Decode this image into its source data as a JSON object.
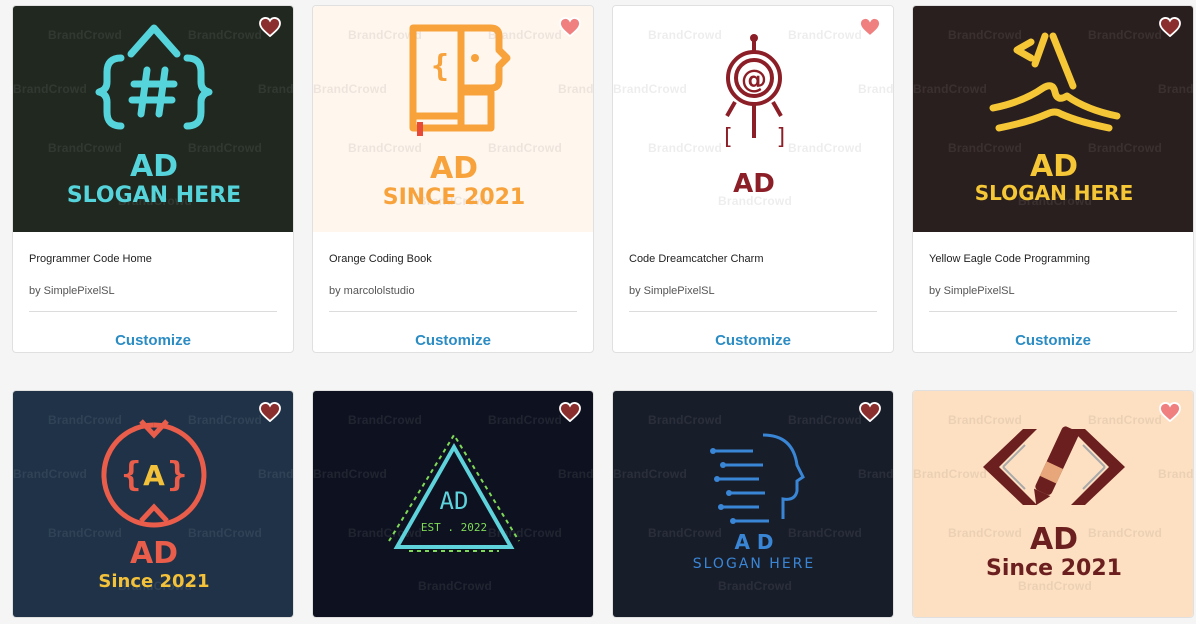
{
  "watermark": "BrandCrowd",
  "cards": [
    {
      "title": "Programmer Code Home",
      "author": "by SimplePixelSL",
      "action": "Customize",
      "logo": {
        "line1": "AD",
        "line2": "SLOGAN HERE",
        "icon": "hash-braces-icon",
        "bg": "#202820",
        "fg": "#56d4db",
        "heart": "#8b2e2e"
      }
    },
    {
      "title": "Orange Coding Book",
      "author": "by marcololstudio",
      "action": "Customize",
      "logo": {
        "line1": "AD",
        "line2": "SINCE 2021",
        "icon": "book-braces-icon",
        "bg": "#fff6ee",
        "fg": "#f7a23b",
        "heart": "#f08080"
      }
    },
    {
      "title": "Code Dreamcatcher Charm",
      "author": "by SimplePixelSL",
      "action": "Customize",
      "logo": {
        "line1": "AD",
        "line2": "",
        "icon": "dreamcatcher-at-icon",
        "bg": "#ffffff",
        "fg": "#8b1e26",
        "heart": "#f08080"
      }
    },
    {
      "title": "Yellow Eagle Code Programming",
      "author": "by SimplePixelSL",
      "action": "Customize",
      "logo": {
        "line1": "AD",
        "line2": "SLOGAN HERE",
        "icon": "eagle-code-icon",
        "bg": "#2a1f1f",
        "fg": "#f5c736",
        "heart": "#8b2e2e"
      }
    },
    {
      "logo": {
        "line1": "AD",
        "line2": "Since 2021",
        "icon": "circle-a-braces-icon",
        "bg": "#1f3247",
        "fg": "#e95d4a",
        "accent": "#f3c13a",
        "heart": "#8b2e2e"
      }
    },
    {
      "logo": {
        "line1": "AD",
        "line2": "EST . 2022",
        "icon": "neon-triangle-icon",
        "bg": "#0e1220",
        "fg": "#5fd3dc",
        "accent": "#7ed957",
        "heart": "#8b2e2e"
      }
    },
    {
      "logo": {
        "line1": "A D",
        "line2": "SLOGAN HERE",
        "icon": "circuit-head-icon",
        "bg": "#181d2a",
        "fg": "#3a86d6",
        "heart": "#8b2e2e"
      }
    },
    {
      "logo": {
        "line1": "AD",
        "line2": "Since 2021",
        "icon": "code-brackets-pencil-icon",
        "bg": "#fde0c2",
        "fg": "#6b1f1f",
        "heart": "#f08080"
      }
    }
  ]
}
